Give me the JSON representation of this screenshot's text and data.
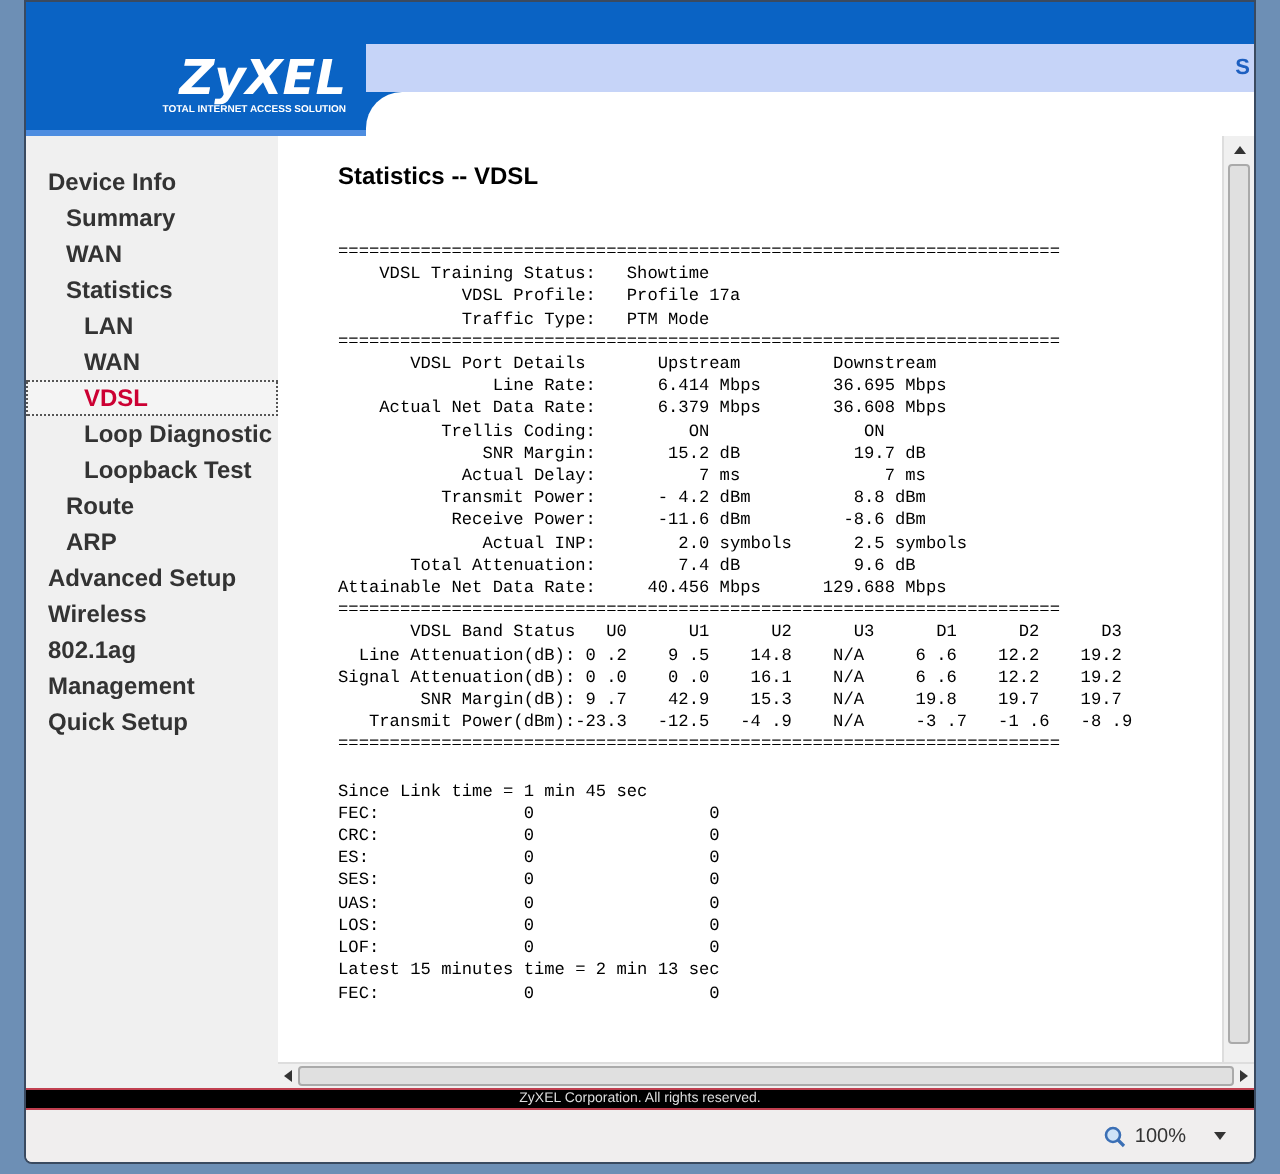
{
  "header": {
    "logo": "ZyXEL",
    "tagline": "TOTAL INTERNET ACCESS SOLUTION",
    "cut_link": "S"
  },
  "sidebar": {
    "items": [
      {
        "label": "Device Info",
        "selected": false,
        "children": [
          {
            "label": "Summary",
            "selected": false
          },
          {
            "label": "WAN",
            "selected": false
          },
          {
            "label": "Statistics",
            "selected": false,
            "children": [
              {
                "label": "LAN",
                "selected": false
              },
              {
                "label": "WAN",
                "selected": false
              },
              {
                "label": "VDSL",
                "selected": true
              },
              {
                "label": "Loop Diagnostic",
                "selected": false
              },
              {
                "label": "Loopback Test",
                "selected": false
              }
            ]
          },
          {
            "label": "Route",
            "selected": false
          },
          {
            "label": "ARP",
            "selected": false
          }
        ]
      },
      {
        "label": "Advanced Setup",
        "selected": false
      },
      {
        "label": "Wireless",
        "selected": false
      },
      {
        "label": "802.1ag",
        "selected": false
      },
      {
        "label": "Management",
        "selected": false
      },
      {
        "label": "Quick Setup",
        "selected": false
      }
    ]
  },
  "content": {
    "title": "Statistics -- VDSL",
    "sections": [
      {
        "lines": [
          "======================================================================",
          "    VDSL Training Status:   Showtime",
          "            VDSL Profile:   Profile 17a",
          "            Traffic Type:   PTM Mode",
          "======================================================================",
          "       VDSL Port Details       Upstream         Downstream",
          "               Line Rate:      6.414 Mbps       36.695 Mbps",
          "    Actual Net Data Rate:      6.379 Mbps       36.608 Mbps",
          "          Trellis Coding:         ON               ON",
          "              SNR Margin:       15.2 dB           19.7 dB",
          "            Actual Delay:          7 ms              7 ms",
          "          Transmit Power:      - 4.2 dBm          8.8 dBm",
          "           Receive Power:      -11.6 dBm         -8.6 dBm",
          "              Actual INP:        2.0 symbols      2.5 symbols",
          "       Total Attenuation:        7.4 dB           9.6 dB",
          "Attainable Net Data Rate:     40.456 Mbps      129.688 Mbps",
          "======================================================================",
          "       VDSL Band Status   U0      U1      U2      U3      D1      D2      D3",
          "  Line Attenuation(dB): 0 .2    9 .5    14.8    N/A     6 .6    12.2    19.2",
          "Signal Attenuation(dB): 0 .0    0 .0    16.1    N/A     6 .6    12.2    19.2",
          "        SNR Margin(dB): 9 .7    42.9    15.3    N/A     19.8    19.7    19.7",
          "   Transmit Power(dBm):-23.3   -12.5   -4 .9    N/A     -3 .7   -1 .6   -8 .9",
          "======================================================================"
        ]
      },
      {
        "lines": [
          "Since Link time = 1 min 45 sec",
          "FEC:              0                 0",
          "CRC:              0                 0",
          "ES:               0                 0",
          "SES:              0                 0",
          "UAS:              0                 0",
          "LOS:              0                 0",
          "LOF:              0                 0",
          "Latest 15 minutes time = 2 min 13 sec",
          "FEC:              0                 0"
        ]
      }
    ]
  },
  "footer": "ZyXEL Corporation. All rights reserved.",
  "status_bar": {
    "zoom": "100%"
  }
}
